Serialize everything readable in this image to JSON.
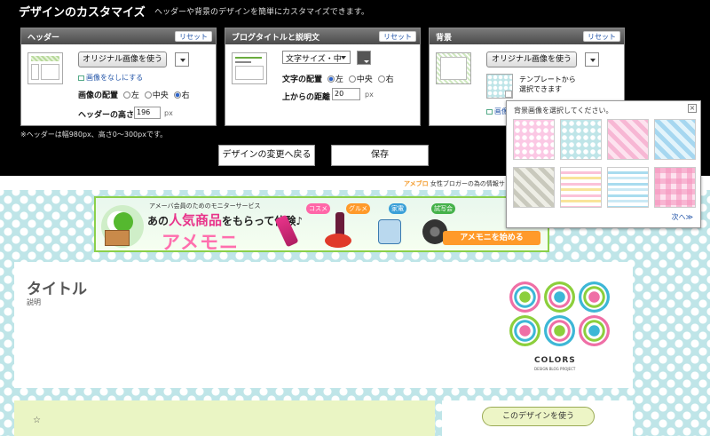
{
  "header": {
    "title": "デザインのカスタマイズ",
    "description": "ヘッダーや背景のデザインを簡単にカスタマイズできます。"
  },
  "panels": {
    "header": {
      "title": "ヘッダー",
      "reset": "リセット",
      "use_image": "オリジナル画像を使う",
      "no_image": "画像をなしにする",
      "align_label": "画像の配置",
      "align_options": [
        "左",
        "中央",
        "右"
      ],
      "align_selected": "右",
      "height_label": "ヘッダーの高さ",
      "height_value": "196",
      "unit": "px"
    },
    "blog_title": {
      "title": "ブログタイトルと説明文",
      "reset": "リセット",
      "font_size": "文字サイズ・中",
      "align_label": "文字の配置",
      "align_options": [
        "左",
        "中央",
        "右"
      ],
      "align_selected": "左",
      "top_label": "上からの距離",
      "top_value": "20",
      "unit": "px"
    },
    "background": {
      "title": "背景",
      "reset": "リセット",
      "use_image": "オリジナル画像を使う",
      "template_text": "テンプレートから",
      "template_text2": "選択できます",
      "image_link": "画像"
    }
  },
  "note": "※ヘッダーは幅980px、高さ0～300pxです。",
  "actions": {
    "back": "デザインの変更へ戻る",
    "save": "保存"
  },
  "topbar": {
    "ameba": "アメブロ",
    "text": "女性ブロガーの為の情報サ"
  },
  "banner": {
    "sub": "アメーバ会員のためのモニターサービス",
    "catch_pre": "あの",
    "catch_pink": "人気商品",
    "catch_post": "をもらって体験♪",
    "brand": "アメモニ",
    "cta": "アメモニを始める",
    "tags": [
      "コスメ",
      "グルメ",
      "家電",
      "試写会"
    ]
  },
  "blog": {
    "title": "タイトル",
    "description": "説明",
    "logo_name": "COLORS",
    "logo_sub": "DESIGN BLOG PROJECT",
    "star": "☆",
    "use_design": "このデザインを使う"
  },
  "popup": {
    "title": "背景画像を選択してください。",
    "close": "×",
    "more": "次へ≫"
  },
  "colors": {
    "preview_bg": "#bfe5e8",
    "accent_green": "#8bd04a",
    "pink": "#e8338a"
  }
}
